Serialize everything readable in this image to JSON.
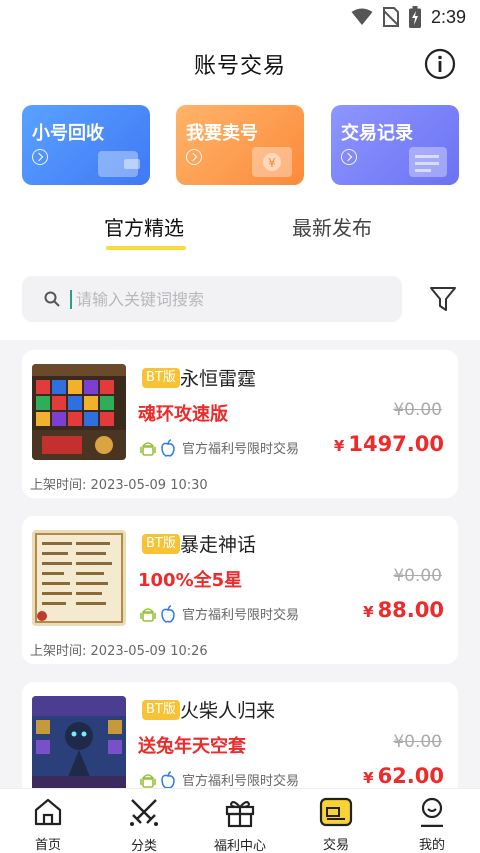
{
  "status_bar": {
    "time": "2:39"
  },
  "header": {
    "title": "账号交易"
  },
  "quick_actions": [
    {
      "label": "小号回收"
    },
    {
      "label": "我要卖号"
    },
    {
      "label": "交易记录"
    }
  ],
  "tabs": [
    {
      "label": "官方精选",
      "active": true
    },
    {
      "label": "最新发布",
      "active": false
    }
  ],
  "search": {
    "placeholder": "请输入关键词搜索",
    "value": ""
  },
  "listings": [
    {
      "badge": "BT版",
      "game": "永恒雷霆",
      "promo": "魂环攻速版",
      "old_price": "¥0.00",
      "currency": "¥",
      "price": "1497.00",
      "platform_text": "官方福利号限时交易",
      "listed_label": "上架时间:",
      "listed_time": "2023-05-09 10:30"
    },
    {
      "badge": "BT版",
      "game": "暴走神话",
      "promo": "100%全5星",
      "old_price": "¥0.00",
      "currency": "¥",
      "price": "88.00",
      "platform_text": "官方福利号限时交易",
      "listed_label": "上架时间:",
      "listed_time": "2023-05-09 10:26"
    },
    {
      "badge": "BT版",
      "game": "火柴人归来",
      "promo": "送兔年天空套",
      "old_price": "¥0.00",
      "currency": "¥",
      "price": "62.00",
      "platform_text": "官方福利号限时交易",
      "listed_label": "",
      "listed_time": ""
    }
  ],
  "bottom_nav": [
    {
      "label": "首页",
      "icon": "home-icon"
    },
    {
      "label": "分类",
      "icon": "crossed-swords-icon"
    },
    {
      "label": "福利中心",
      "icon": "gift-icon"
    },
    {
      "label": "交易",
      "icon": "trade-card-icon"
    },
    {
      "label": "我的",
      "icon": "profile-icon"
    }
  ],
  "colors": {
    "price_red": "#ee2a2a",
    "tab_underline": "#f7dc3b",
    "badge": "#f7c233"
  }
}
